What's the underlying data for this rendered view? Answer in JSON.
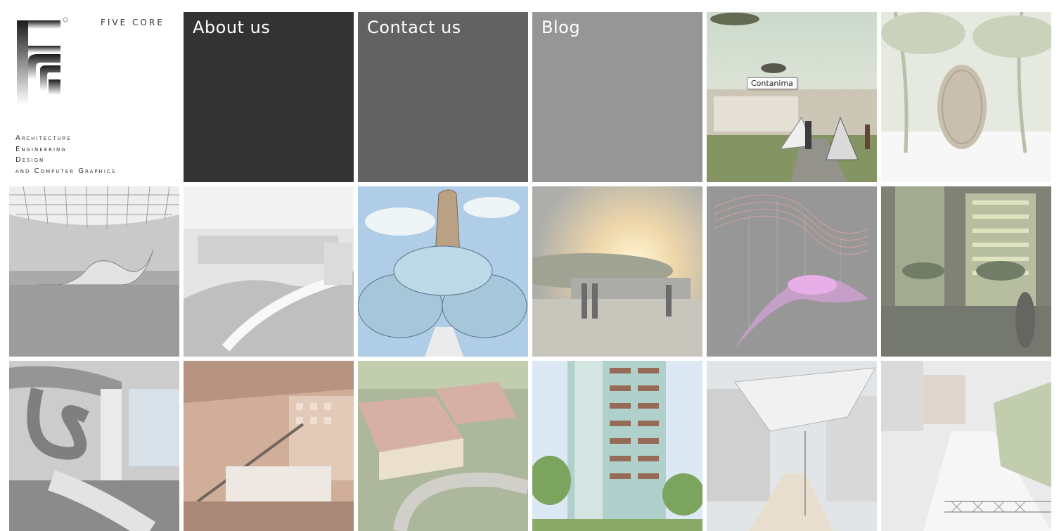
{
  "brand": {
    "name": "FIVE CORE",
    "tagline": [
      "Architecture",
      "Engineering",
      "Design",
      "and Computer Graphics"
    ]
  },
  "nav": {
    "about": "About us",
    "contact": "Contact us",
    "blog": "Blog"
  },
  "tooltip": "Contanima",
  "colors": {
    "about_bg": "#333333",
    "contact_bg": "#626262",
    "blog_bg": "#969696",
    "page_bg": "#ffffff"
  }
}
